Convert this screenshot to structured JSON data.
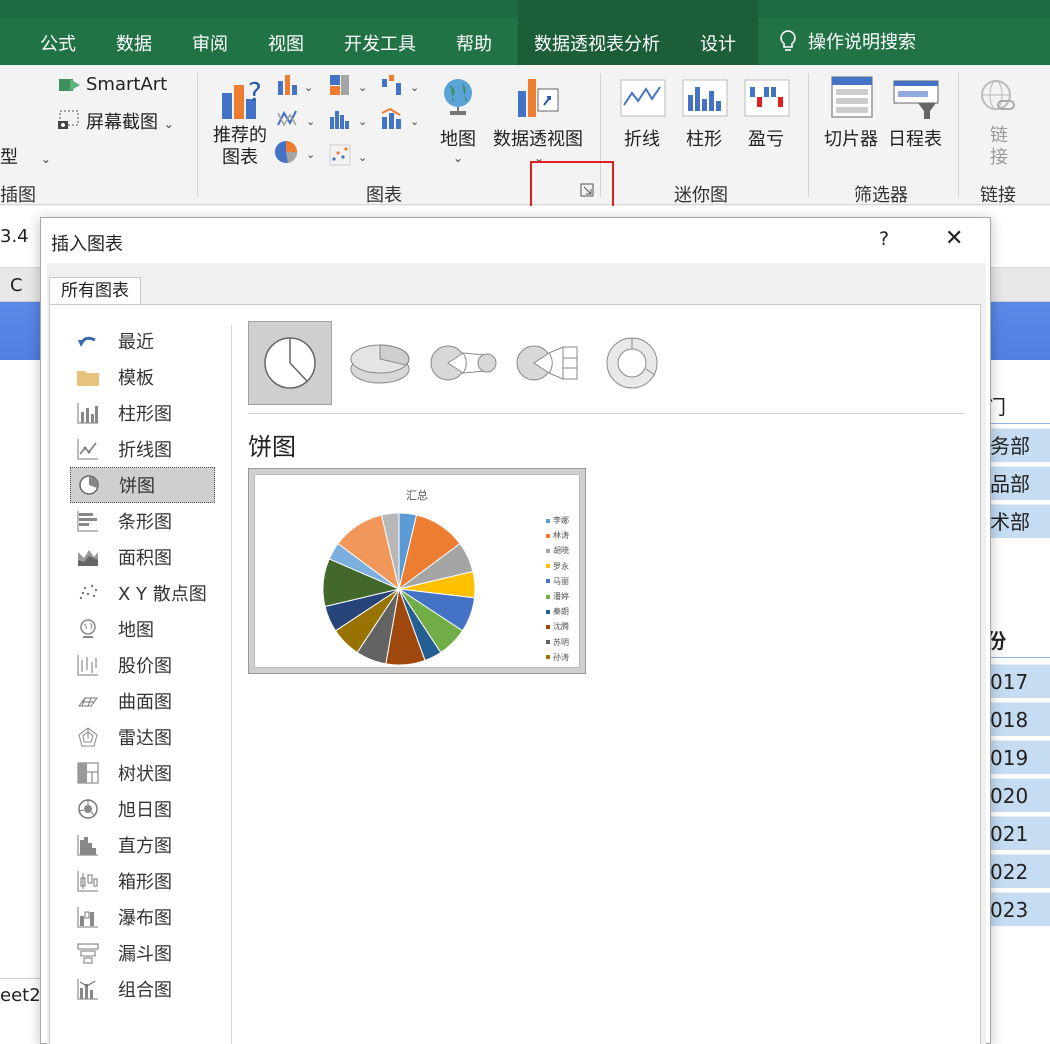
{
  "ribbon_tabs": [
    "公式",
    "数据",
    "审阅",
    "视图",
    "开发工具",
    "帮助",
    "数据透视表分析",
    "设计"
  ],
  "tell_me": "操作说明搜索",
  "ribbon": {
    "smartart": "SmartArt",
    "screenshot": "屏幕截图",
    "left_cut_label": "型",
    "left_group": "插图",
    "recommended_charts": "推荐的\n图表",
    "recommended_line1": "推荐的",
    "recommended_line2": "图表",
    "maps": "地图",
    "pivot_chart": "数据透视图",
    "charts_group": "图表",
    "sparkline_line": "折线",
    "sparkline_column": "柱形",
    "sparkline_winloss": "盈亏",
    "sparkline_group": "迷你图",
    "slicer": "切片器",
    "timeline": "日程表",
    "filter_group": "筛选器",
    "link_line1": "链",
    "link_line2": "接",
    "link_group": "链接"
  },
  "sheet": {
    "name_box_fragment": "3.4",
    "column_c": "C",
    "sheet_tab": "eet2",
    "right_cells": [
      "门",
      "务部",
      "品部",
      "术部",
      "份",
      "017",
      "018",
      "019",
      "020",
      "021",
      "022",
      "023"
    ]
  },
  "dialog": {
    "title": "插入图表",
    "help": "?",
    "close": "✕",
    "tab": "所有图表",
    "categories": [
      {
        "label": "最近",
        "icon": "recent-icon"
      },
      {
        "label": "模板",
        "icon": "folder-icon"
      },
      {
        "label": "柱形图",
        "icon": "column-chart-icon"
      },
      {
        "label": "折线图",
        "icon": "line-chart-icon"
      },
      {
        "label": "饼图",
        "icon": "pie-chart-icon",
        "selected": true
      },
      {
        "label": "条形图",
        "icon": "bar-chart-icon"
      },
      {
        "label": "面积图",
        "icon": "area-chart-icon"
      },
      {
        "label": "X Y 散点图",
        "icon": "scatter-chart-icon"
      },
      {
        "label": "地图",
        "icon": "map-chart-icon"
      },
      {
        "label": "股价图",
        "icon": "stock-chart-icon"
      },
      {
        "label": "曲面图",
        "icon": "surface-chart-icon"
      },
      {
        "label": "雷达图",
        "icon": "radar-chart-icon"
      },
      {
        "label": "树状图",
        "icon": "treemap-chart-icon"
      },
      {
        "label": "旭日图",
        "icon": "sunburst-chart-icon"
      },
      {
        "label": "直方图",
        "icon": "histogram-chart-icon"
      },
      {
        "label": "箱形图",
        "icon": "box-chart-icon"
      },
      {
        "label": "瀑布图",
        "icon": "waterfall-chart-icon"
      },
      {
        "label": "漏斗图",
        "icon": "funnel-chart-icon"
      },
      {
        "label": "组合图",
        "icon": "combo-chart-icon"
      }
    ],
    "subtypes": [
      "pie",
      "3d-pie",
      "pie-of-pie",
      "bar-of-pie",
      "doughnut"
    ],
    "selected_type_title": "饼图",
    "preview": {
      "title": "汇总",
      "legend": [
        "李娜",
        "林涛",
        "胡晓",
        "罗永",
        "马丽",
        "潘婷",
        "秦朗",
        "沈腾",
        "苏明",
        "孙涛"
      ]
    }
  },
  "colors": {
    "ribbon_green": "#217346",
    "highlight_red": "#e02020",
    "selected_gray": "#cfcfcf"
  },
  "pie_slices": [
    {
      "value": 4,
      "color": "#5b9bd5"
    },
    {
      "value": 12,
      "color": "#ed7d31"
    },
    {
      "value": 7,
      "color": "#a5a5a5"
    },
    {
      "value": 6,
      "color": "#ffc000"
    },
    {
      "value": 8,
      "color": "#4472c4"
    },
    {
      "value": 7,
      "color": "#70ad47"
    },
    {
      "value": 4,
      "color": "#255e91"
    },
    {
      "value": 9,
      "color": "#9e480e"
    },
    {
      "value": 7,
      "color": "#636363"
    },
    {
      "value": 7,
      "color": "#997300"
    },
    {
      "value": 6,
      "color": "#264478"
    },
    {
      "value": 11,
      "color": "#43682b"
    },
    {
      "value": 4,
      "color": "#7cafdd"
    },
    {
      "value": 12,
      "color": "#f1975a"
    },
    {
      "value": 4,
      "color": "#b7b7b7"
    }
  ]
}
